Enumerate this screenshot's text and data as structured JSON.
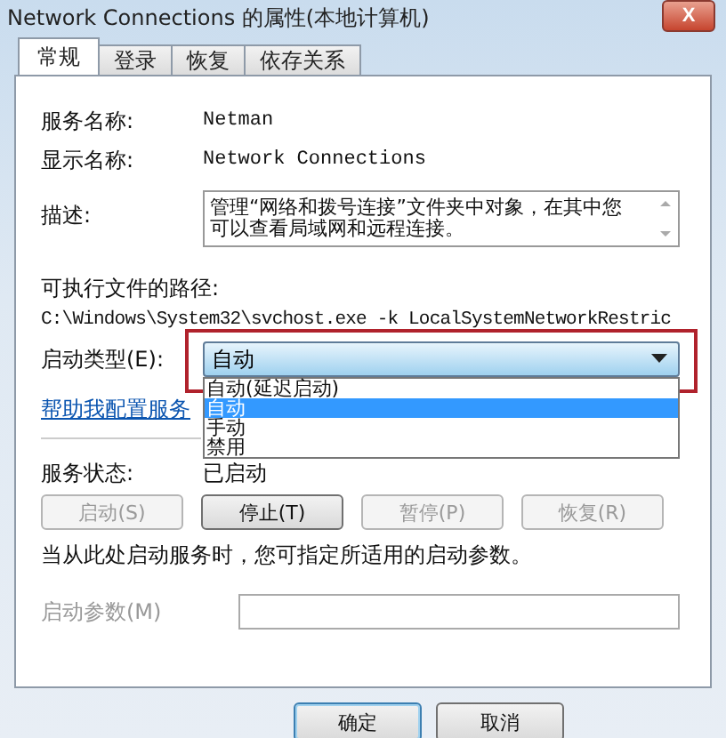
{
  "window": {
    "title": "Network Connections 的属性(本地计算机)",
    "close": "X"
  },
  "tabs": [
    {
      "label": "常规",
      "selected": true
    },
    {
      "label": "登录",
      "selected": false
    },
    {
      "label": "恢复",
      "selected": false
    },
    {
      "label": "依存关系",
      "selected": false
    }
  ],
  "fields": [
    {
      "label": "服务名称:",
      "value": "Netman"
    },
    {
      "label": "显示名称:",
      "value": "Network Connections"
    }
  ],
  "description": {
    "label": "描述:",
    "value": "管理“网络和拨号连接”文件夹中对象，在其中您可以查看局域网和远程连接。"
  },
  "path": {
    "label": "可执行文件的路径:",
    "value": "C:\\Windows\\System32\\svchost.exe -k LocalSystemNetworkRestric"
  },
  "startup_type": {
    "label": "启动类型(E):",
    "value": "自动",
    "highlighted": true,
    "expanded": true,
    "options": [
      {
        "label": "自动(延迟启动)",
        "selected": false
      },
      {
        "label": "自动",
        "selected": true
      },
      {
        "label": "手动",
        "selected": false
      },
      {
        "label": "禁用",
        "selected": false
      }
    ]
  },
  "help_link": "帮助我配置服务",
  "service_status": {
    "label": "服务状态:",
    "value": "已启动"
  },
  "service_buttons": [
    {
      "label": "启动(S)",
      "disabled": true
    },
    {
      "label": "停止(T)",
      "disabled": false
    },
    {
      "label": "暂停(P)",
      "disabled": true
    },
    {
      "label": "恢复(R)",
      "disabled": true
    }
  ],
  "hint": "当从此处启动服务时，您可指定所适用的启动参数。",
  "parameters": {
    "label": "启动参数(M)",
    "disabled": true
  },
  "dialog_buttons": [
    {
      "label": "确定",
      "default": true
    },
    {
      "label": "取消",
      "default": false
    }
  ]
}
